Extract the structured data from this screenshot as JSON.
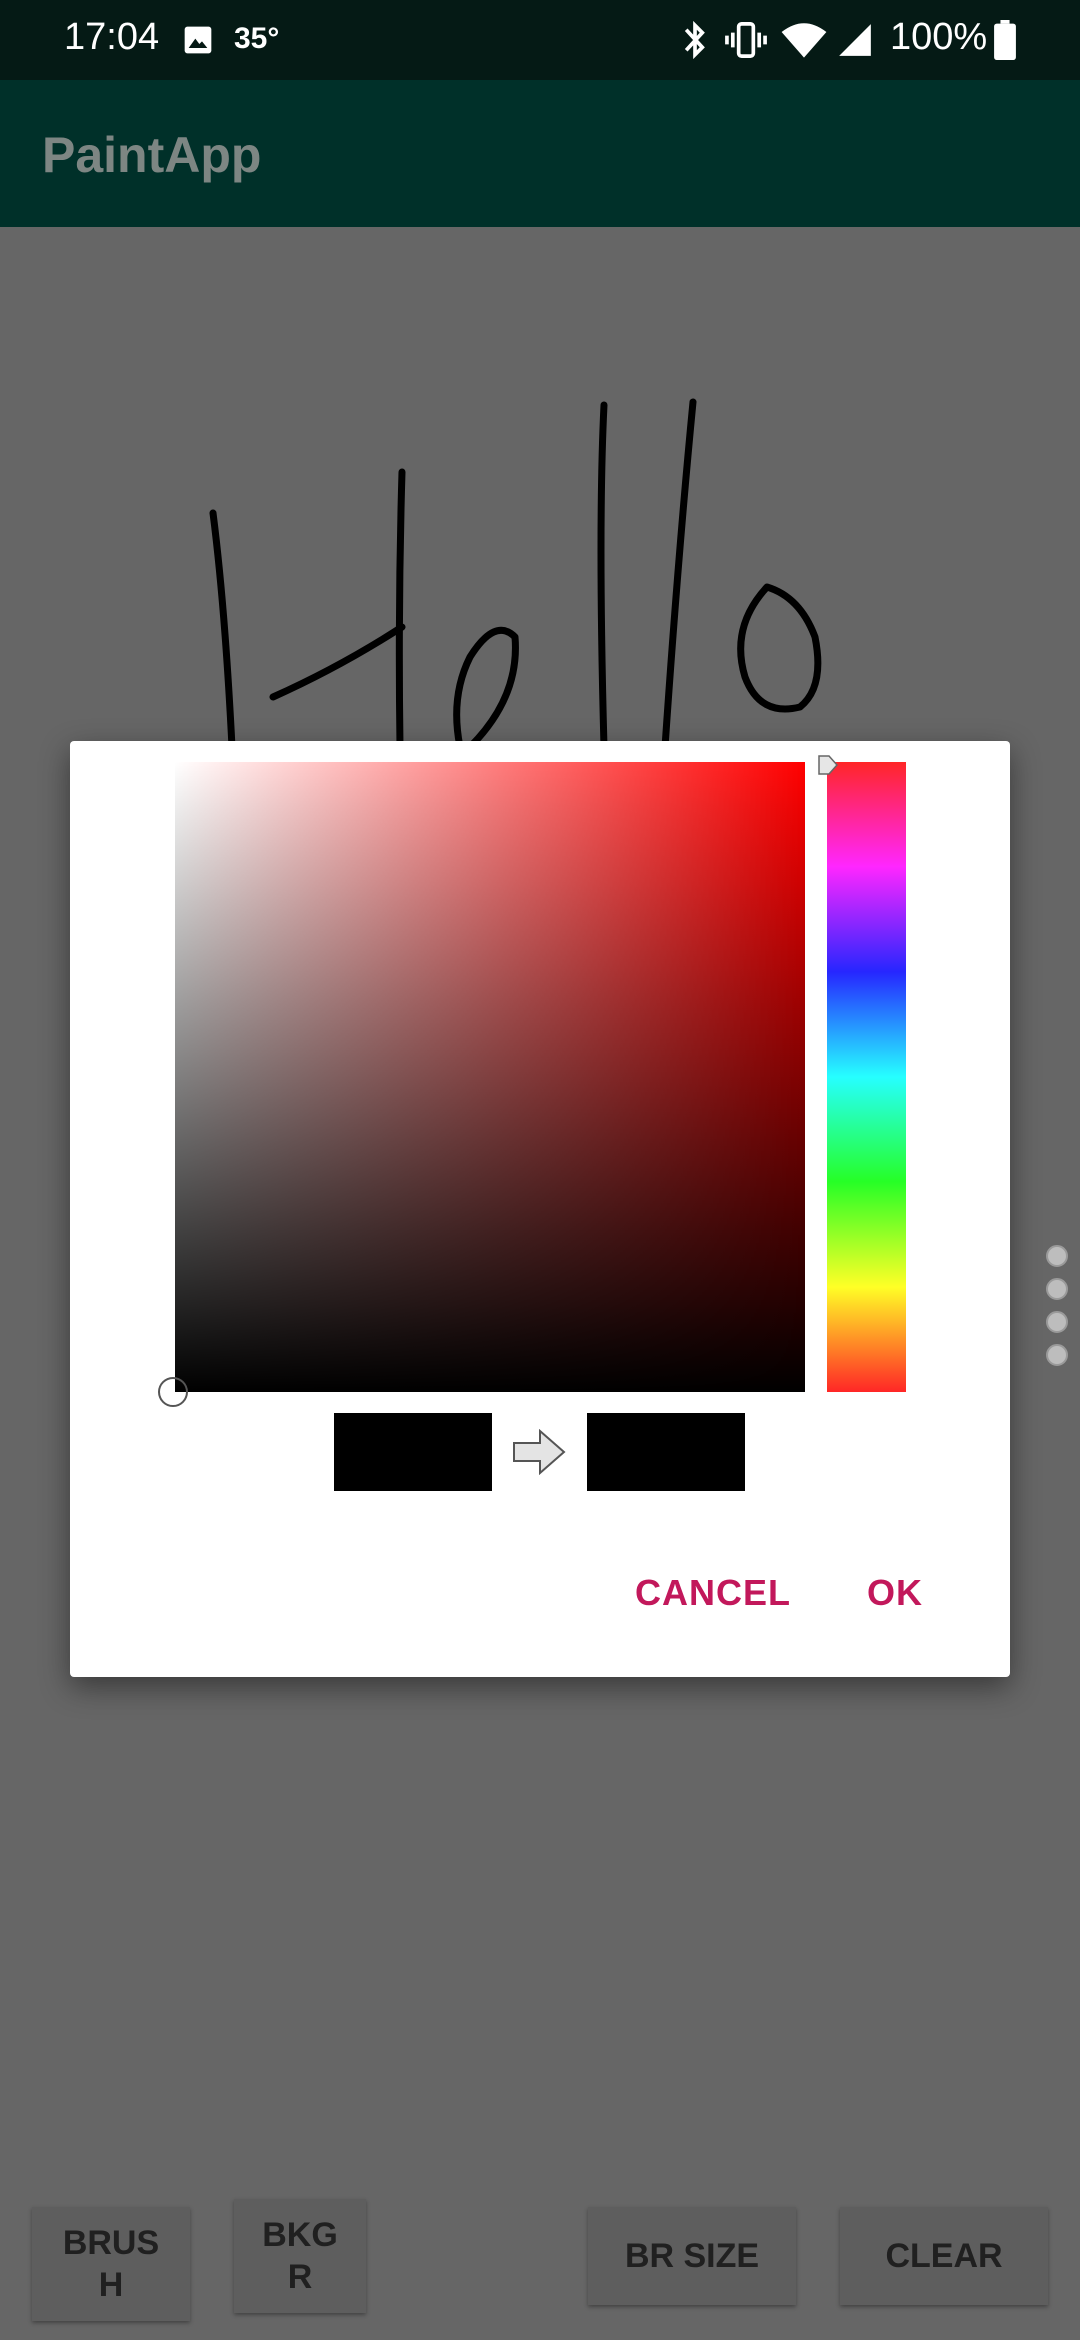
{
  "status_bar": {
    "time": "17:04",
    "temperature": "35°",
    "battery_percent": "100%",
    "icons": [
      "image-icon",
      "bluetooth-icon",
      "vibrate-icon",
      "wifi-icon",
      "signal-icon",
      "battery-icon"
    ]
  },
  "app_bar": {
    "title": "PaintApp"
  },
  "canvas": {
    "drawing_text": "Hello",
    "stroke_color": "#000000",
    "background": "#ffffff"
  },
  "dialog": {
    "hue_color": "#ff0000",
    "previous_color": "#000000",
    "new_color": "#000000",
    "cancel_label": "CANCEL",
    "ok_label": "OK"
  },
  "bottom_bar": {
    "brush_label": "BRUS\nH",
    "bkgr_label": "BKG\nR",
    "br_size_label": "BR SIZE",
    "clear_label": "CLEAR"
  },
  "colors": {
    "accent": "#c2185b",
    "app_bar": "#003029",
    "status_bar": "#051a15"
  }
}
